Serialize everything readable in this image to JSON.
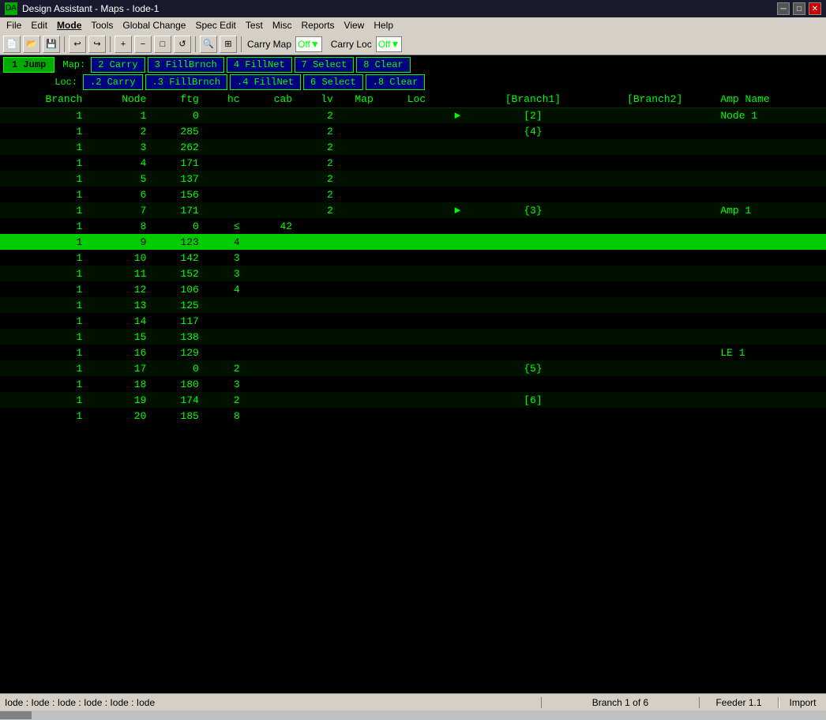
{
  "titlebar": {
    "icon": "DA",
    "title": "Design Assistant - Maps - Iode-1",
    "controls": [
      "minimize",
      "maximize",
      "close"
    ]
  },
  "menubar": {
    "items": [
      "File",
      "Edit",
      "Mode",
      "Tools",
      "Global Change",
      "Spec Edit",
      "Test",
      "Misc",
      "Reports",
      "View",
      "Help"
    ]
  },
  "toolbar": {
    "carry_map_label": "Carry Map",
    "carry_map_value": "Off",
    "carry_loc_label": "Carry Loc",
    "carry_loc_value": "Off",
    "carry_loc_off_label": "Carry Loc Off"
  },
  "btn_rows": {
    "jump_label": "1 Jump",
    "map_label": "Map:",
    "loc_label": "Loc:",
    "map_buttons": [
      {
        "label": "2 Carry",
        "active": false
      },
      {
        "label": "3 FillBrnch",
        "active": false
      },
      {
        "label": "4 FillNet",
        "active": false
      },
      {
        "label": "7 Select",
        "active": false
      },
      {
        "label": "8 Clear",
        "active": false
      }
    ],
    "loc_buttons": [
      {
        "label": ".2 Carry",
        "active": false
      },
      {
        "label": ".3 FillBrnch",
        "active": false
      },
      {
        "label": ".4 FillNet",
        "active": false
      },
      {
        "label": "6 Select",
        "active": false
      },
      {
        "label": ".8 Clear",
        "active": false
      }
    ]
  },
  "table": {
    "headers": [
      "Branch",
      "Node",
      "ftg",
      "hc",
      "cab",
      "lv",
      "Map",
      "Loc",
      "",
      "[Branch1]",
      "[Branch2]",
      "Amp Name"
    ],
    "rows": [
      {
        "branch": "1",
        "node": "1",
        "ftg": "0",
        "hc": "",
        "cab": "",
        "lv": "2",
        "map": "",
        "loc": "",
        "arrow": "►",
        "branch1": "[2]",
        "branch2": "",
        "amp_name": "Node 1",
        "highlighted": false
      },
      {
        "branch": "1",
        "node": "2",
        "ftg": "285",
        "hc": "",
        "cab": "",
        "lv": "2",
        "map": "",
        "loc": "",
        "arrow": "",
        "branch1": "{4}",
        "branch2": "",
        "amp_name": "",
        "highlighted": false
      },
      {
        "branch": "1",
        "node": "3",
        "ftg": "262",
        "hc": "",
        "cab": "",
        "lv": "2",
        "map": "",
        "loc": "",
        "arrow": "",
        "branch1": "",
        "branch2": "",
        "amp_name": "",
        "highlighted": false
      },
      {
        "branch": "1",
        "node": "4",
        "ftg": "171",
        "hc": "",
        "cab": "",
        "lv": "2",
        "map": "",
        "loc": "",
        "arrow": "",
        "branch1": "",
        "branch2": "",
        "amp_name": "",
        "highlighted": false
      },
      {
        "branch": "1",
        "node": "5",
        "ftg": "137",
        "hc": "",
        "cab": "",
        "lv": "2",
        "map": "",
        "loc": "",
        "arrow": "",
        "branch1": "",
        "branch2": "",
        "amp_name": "",
        "highlighted": false
      },
      {
        "branch": "1",
        "node": "6",
        "ftg": "156",
        "hc": "",
        "cab": "",
        "lv": "2",
        "map": "",
        "loc": "",
        "arrow": "",
        "branch1": "",
        "branch2": "",
        "amp_name": "",
        "highlighted": false
      },
      {
        "branch": "1",
        "node": "7",
        "ftg": "171",
        "hc": "",
        "cab": "",
        "lv": "2",
        "map": "",
        "loc": "",
        "arrow": "►",
        "branch1": "{3}",
        "branch2": "",
        "amp_name": "Amp 1",
        "highlighted": false
      },
      {
        "branch": "1",
        "node": "8",
        "ftg": "0",
        "hc": "≤",
        "cab": "42",
        "lv": "",
        "map": "",
        "loc": "",
        "arrow": "",
        "branch1": "",
        "branch2": "",
        "amp_name": "",
        "highlighted": false
      },
      {
        "branch": "1",
        "node": "9",
        "ftg": "123",
        "hc": "4",
        "cab": "",
        "lv": "",
        "map": "",
        "loc": "",
        "arrow": "",
        "branch1": "",
        "branch2": "",
        "amp_name": "",
        "highlighted": true
      },
      {
        "branch": "1",
        "node": "10",
        "ftg": "142",
        "hc": "3",
        "cab": "",
        "lv": "",
        "map": "",
        "loc": "",
        "arrow": "",
        "branch1": "",
        "branch2": "",
        "amp_name": "",
        "highlighted": false
      },
      {
        "branch": "1",
        "node": "11",
        "ftg": "152",
        "hc": "3",
        "cab": "",
        "lv": "",
        "map": "",
        "loc": "",
        "arrow": "",
        "branch1": "",
        "branch2": "",
        "amp_name": "",
        "highlighted": false
      },
      {
        "branch": "1",
        "node": "12",
        "ftg": "106",
        "hc": "4",
        "cab": "",
        "lv": "",
        "map": "",
        "loc": "",
        "arrow": "",
        "branch1": "",
        "branch2": "",
        "amp_name": "",
        "highlighted": false
      },
      {
        "branch": "1",
        "node": "13",
        "ftg": "125",
        "hc": "",
        "cab": "",
        "lv": "",
        "map": "",
        "loc": "",
        "arrow": "",
        "branch1": "",
        "branch2": "",
        "amp_name": "",
        "highlighted": false
      },
      {
        "branch": "1",
        "node": "14",
        "ftg": "117",
        "hc": "",
        "cab": "",
        "lv": "",
        "map": "",
        "loc": "",
        "arrow": "",
        "branch1": "",
        "branch2": "",
        "amp_name": "",
        "highlighted": false
      },
      {
        "branch": "1",
        "node": "15",
        "ftg": "138",
        "hc": "",
        "cab": "",
        "lv": "",
        "map": "",
        "loc": "",
        "arrow": "",
        "branch1": "",
        "branch2": "",
        "amp_name": "",
        "highlighted": false
      },
      {
        "branch": "1",
        "node": "16",
        "ftg": "129",
        "hc": "",
        "cab": "",
        "lv": "",
        "map": "",
        "loc": "",
        "arrow": "",
        "branch1": "",
        "branch2": "",
        "amp_name": "LE 1",
        "highlighted": false
      },
      {
        "branch": "1",
        "node": "17",
        "ftg": "0",
        "hc": "2",
        "cab": "",
        "lv": "",
        "map": "",
        "loc": "",
        "arrow": "",
        "branch1": "{5}",
        "branch2": "",
        "amp_name": "",
        "highlighted": false
      },
      {
        "branch": "1",
        "node": "18",
        "ftg": "180",
        "hc": "3",
        "cab": "",
        "lv": "",
        "map": "",
        "loc": "",
        "arrow": "",
        "branch1": "",
        "branch2": "",
        "amp_name": "",
        "highlighted": false
      },
      {
        "branch": "1",
        "node": "19",
        "ftg": "174",
        "hc": "2",
        "cab": "",
        "lv": "",
        "map": "",
        "loc": "",
        "arrow": "",
        "branch1": "[6]",
        "branch2": "",
        "amp_name": "",
        "highlighted": false
      },
      {
        "branch": "1",
        "node": "20",
        "ftg": "185",
        "hc": "8",
        "cab": "",
        "lv": "",
        "map": "",
        "loc": "",
        "arrow": "",
        "branch1": "",
        "branch2": "",
        "amp_name": "",
        "highlighted": false
      }
    ]
  },
  "statusbar": {
    "path": "Iode : Iode : Iode : Iode : Iode : Iode",
    "branch_info": "Branch 1 of 6",
    "feeder_info": "Feeder 1.1",
    "import_label": "Import"
  }
}
